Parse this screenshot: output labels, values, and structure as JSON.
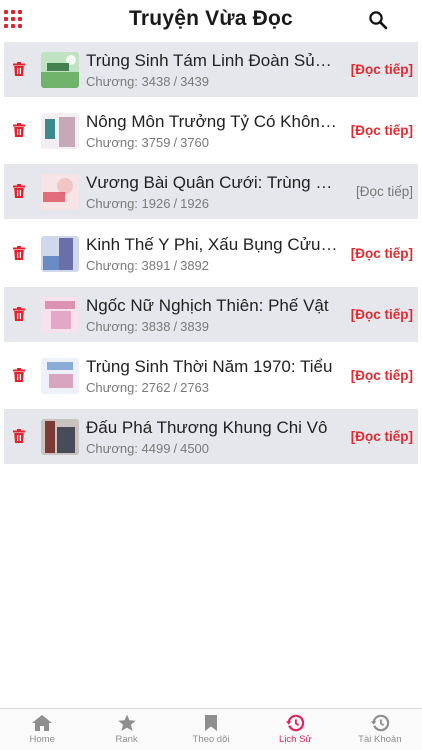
{
  "header": {
    "title": "Truyện Vừa Đọc",
    "menu_icon": "grid-menu-icon",
    "search_icon": "search-icon",
    "accent_color": "#e0242f"
  },
  "list": {
    "items": [
      {
        "title": "Trùng Sinh Tám Linh Đoàn Sủng Thê",
        "current": "3438",
        "total": "3439",
        "chapter_label": "Chương:",
        "action": "[Đọc tiếp]",
        "read": false
      },
      {
        "title": "Nông Môn Trưởng Tỷ Có Không Gian",
        "current": "3759",
        "total": "3760",
        "chapter_label": "Chương:",
        "action": "[Đọc tiếp]",
        "read": false
      },
      {
        "title": "Vương Bài Quân Cưới: Trùng Sinh",
        "current": "1926",
        "total": "1926",
        "chapter_label": "Chương:",
        "action": "[Đọc tiếp]",
        "read": true
      },
      {
        "title": "Kinh Thế Y Phi, Xấu Bụng Cửu Vương",
        "current": "3891",
        "total": "3892",
        "chapter_label": "Chương:",
        "action": "[Đọc tiếp]",
        "read": false
      },
      {
        "title": "Ngốc Nữ Nghịch Thiên: Phế Vật",
        "current": "3838",
        "total": "3839",
        "chapter_label": "Chương:",
        "action": "[Đọc tiếp]",
        "read": false
      },
      {
        "title": "Trùng Sinh Thời Năm 1970: Tiểu",
        "current": "2762",
        "total": "2763",
        "chapter_label": "Chương:",
        "action": "[Đọc tiếp]",
        "read": false
      },
      {
        "title": "Đấu Phá Thương Khung Chi Vô",
        "current": "4499",
        "total": "4500",
        "chapter_label": "Chương:",
        "action": "[Đọc tiếp]",
        "read": false
      }
    ]
  },
  "tabbar": {
    "tabs": [
      {
        "label": "Home",
        "icon": "home-icon"
      },
      {
        "label": "Rank",
        "icon": "star-icon"
      },
      {
        "label": "Theo dõi",
        "icon": "bookmark-icon"
      },
      {
        "label": "Lịch Sử",
        "icon": "history-icon",
        "active": true
      },
      {
        "label": "Tài Khoản",
        "icon": "history-icon"
      }
    ],
    "active_color": "#e0245e"
  }
}
